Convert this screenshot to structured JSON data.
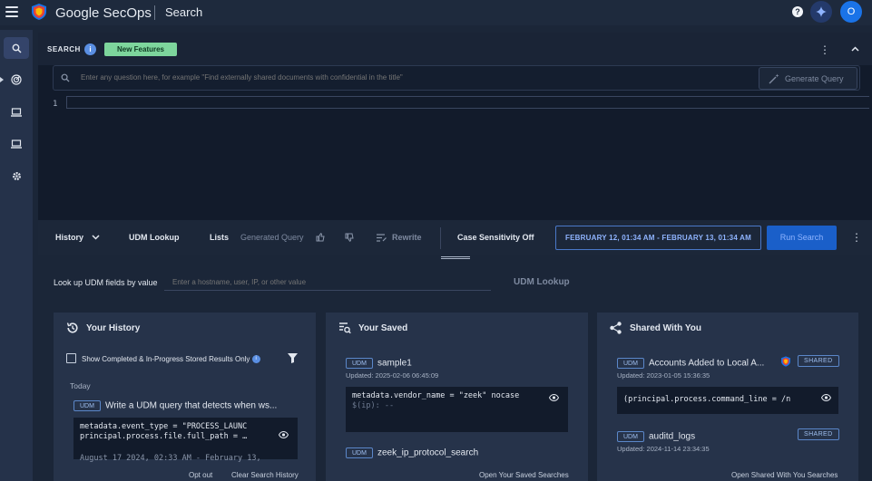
{
  "app": {
    "brand": "Google SecOps",
    "page": "Search",
    "help_glyph": "?",
    "avatar_initial": "O",
    "accent": "#1a73e8"
  },
  "rail": {
    "items": [
      {
        "name": "search-icon",
        "active": true
      },
      {
        "name": "radar-icon",
        "active": false
      },
      {
        "name": "monitor-icon",
        "active": false
      },
      {
        "name": "monitor-icon",
        "active": false
      },
      {
        "name": "gear-icon",
        "active": false
      }
    ]
  },
  "search": {
    "title": "SEARCH",
    "info_glyph": "i",
    "badge": "New Features",
    "nl_placeholder": "Enter any question here, for example \"Find externally shared documents with confidential in the title\"",
    "generate_label": "Generate Query",
    "line_number": "1"
  },
  "toolbar": {
    "history": "History",
    "udm_lookup": "UDM Lookup",
    "lists": "Lists",
    "generated_query": "Generated Query",
    "rewrite": "Rewrite",
    "case_sensitivity": "Case Sensitivity Off",
    "date_range": "FEBRUARY 12, 01:34 AM - FEBRUARY 13, 01:34 AM",
    "run_search": "Run Search"
  },
  "lookup": {
    "label": "Look up UDM fields by value",
    "placeholder": "Enter a hostname, user, IP, or other value",
    "button": "UDM Lookup"
  },
  "history_card": {
    "title": "Your History",
    "checkbox_label": "Show Completed & In-Progress Stored Results Only",
    "section": "Today",
    "item": {
      "tag": "UDM",
      "title": "Write a UDM query that detects when ws...",
      "code_line1": "metadata.event_type = \"PROCESS_LAUNC",
      "code_line2": "principal.process.file.full_path = …",
      "timestamp": "August 17 2024, 02:33 AM - February 13,"
    },
    "opt_out": "Opt out",
    "clear": "Clear Search History"
  },
  "saved_card": {
    "title": "Your Saved",
    "items": [
      {
        "tag": "UDM",
        "title": "sample1",
        "updated": "Updated: 2025-02-06 06:45:09",
        "code_line1": "metadata.vendor_name = \"zeek\" nocase",
        "code_line2": "$(ip): --"
      },
      {
        "tag": "UDM",
        "title": "zeek_ip_protocol_search"
      }
    ],
    "open_link": "Open Your Saved Searches"
  },
  "shared_card": {
    "title": "Shared With You",
    "items": [
      {
        "tag": "UDM",
        "title": "Accounts Added to Local A...",
        "updated": "Updated: 2023-01-05 15:36:35",
        "badge": "SHARED",
        "code_line1": "(principal.process.command_line = /n"
      },
      {
        "tag": "UDM",
        "title": "auditd_logs",
        "updated": "Updated: 2024-11-14 23:34:35",
        "badge": "SHARED"
      }
    ],
    "open_link": "Open Shared With You Searches"
  }
}
